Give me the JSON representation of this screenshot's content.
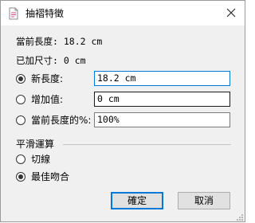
{
  "window": {
    "title": "抽褶特徵",
    "close_icon": "close-icon",
    "app_icon": "document-icon"
  },
  "info": {
    "current_length": "當前長度: 18.2 cm",
    "added_size": "已加尺寸: 0 cm"
  },
  "options": [
    {
      "label": "新長度:",
      "value": "18.2 cm",
      "checked": true
    },
    {
      "label": "增加值:",
      "value": "0 cm",
      "checked": false
    },
    {
      "label": "當前長度的%:",
      "value": "100%",
      "checked": false
    }
  ],
  "smoothing": {
    "title": "平滑運算",
    "items": [
      {
        "label": "切線",
        "checked": false
      },
      {
        "label": "最佳吻合",
        "checked": true
      }
    ]
  },
  "buttons": {
    "ok": "確定",
    "cancel": "取消"
  },
  "colors": {
    "focus_border": "#0078d7",
    "dialog_bg": "#f0f0f0"
  }
}
